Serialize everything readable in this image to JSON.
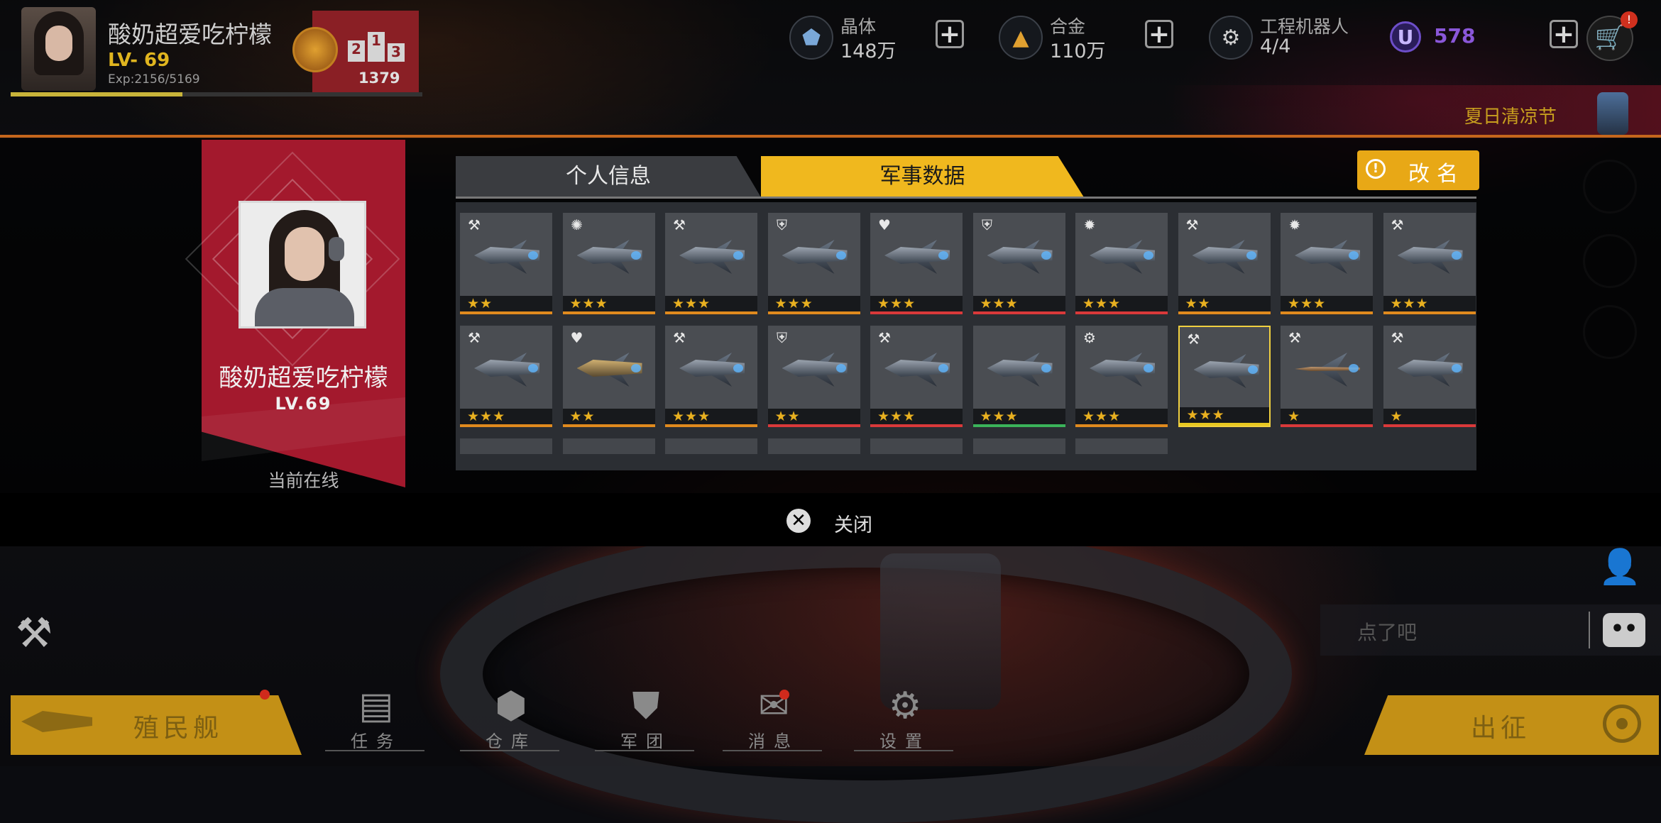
{
  "player": {
    "name": "酸奶超爱吃柠檬",
    "level": "LV- 69",
    "exp": "Exp:2156/5169",
    "exp_progress": 0.417,
    "rank_number": "1379",
    "podium": [
      "2",
      "1",
      "3"
    ]
  },
  "resources": [
    {
      "icon": "crystal-icon",
      "label": "晶体",
      "value": "148万"
    },
    {
      "icon": "alloy-icon",
      "label": "合金",
      "value": "110万"
    },
    {
      "icon": "robot-icon",
      "label": "工程机器人",
      "value": "4/4"
    }
  ],
  "premium": {
    "icon_letter": "U",
    "value": "578"
  },
  "cart_badge": "!",
  "event": {
    "label": "夏日清凉节"
  },
  "profile": {
    "name": "酸奶超爱吃柠檬",
    "level": "LV.69",
    "status": "当前在线",
    "tabs": [
      {
        "label": "个人信息",
        "active": false
      },
      {
        "label": "军事数据",
        "active": true
      }
    ],
    "rename_label": "改名",
    "close_label": "关闭"
  },
  "ships": [
    {
      "stars": 2,
      "class": "⚒",
      "rarity": "#e08a1e"
    },
    {
      "stars": 3,
      "class": "✺",
      "rarity": "#e08a1e"
    },
    {
      "stars": 3,
      "class": "⚒",
      "rarity": "#e08a1e"
    },
    {
      "stars": 3,
      "class": "⛨",
      "rarity": "#e08a1e"
    },
    {
      "stars": 3,
      "class": "♥",
      "rarity": "#d9393a"
    },
    {
      "stars": 3,
      "class": "⛨",
      "rarity": "#d9393a"
    },
    {
      "stars": 3,
      "class": "✹",
      "rarity": "#d9393a"
    },
    {
      "stars": 2,
      "class": "⚒",
      "rarity": "#e08a1e"
    },
    {
      "stars": 3,
      "class": "✹",
      "rarity": "#e08a1e"
    },
    {
      "stars": 3,
      "class": "⚒",
      "rarity": "#e08a1e"
    },
    {
      "stars": 3,
      "class": "⚒",
      "rarity": "#e08a1e"
    },
    {
      "stars": 2,
      "class": "♥",
      "rarity": "#e08a1e"
    },
    {
      "stars": 3,
      "class": "⚒",
      "rarity": "#e08a1e"
    },
    {
      "stars": 2,
      "class": "⛨",
      "rarity": "#d9393a"
    },
    {
      "stars": 3,
      "class": "⚒",
      "rarity": "#d9393a"
    },
    {
      "stars": 3,
      "class": "",
      "rarity": "#3bb35a"
    },
    {
      "stars": 3,
      "class": "⚙",
      "rarity": "#e08a1e"
    },
    {
      "stars": 3,
      "class": "⚒",
      "rarity": "#e8c820",
      "selected": true
    },
    {
      "stars": 1,
      "class": "⚒",
      "rarity": "#d9393a"
    },
    {
      "stars": 1,
      "class": "⚒",
      "rarity": "#d9393a"
    }
  ],
  "bottom": {
    "colony_label": "殖民舰",
    "depart_label": "出征",
    "chat_placeholder": "点了吧",
    "nav": [
      {
        "label": "任务",
        "icon": "mission-icon"
      },
      {
        "label": "仓库",
        "icon": "warehouse-icon"
      },
      {
        "label": "军团",
        "icon": "legion-icon"
      },
      {
        "label": "消息",
        "icon": "message-icon"
      },
      {
        "label": "设置",
        "icon": "settings-icon"
      }
    ]
  },
  "colors": {
    "accent": "#f0b81e",
    "ribbon": "#a3192d",
    "premium": "#8a57d9"
  }
}
